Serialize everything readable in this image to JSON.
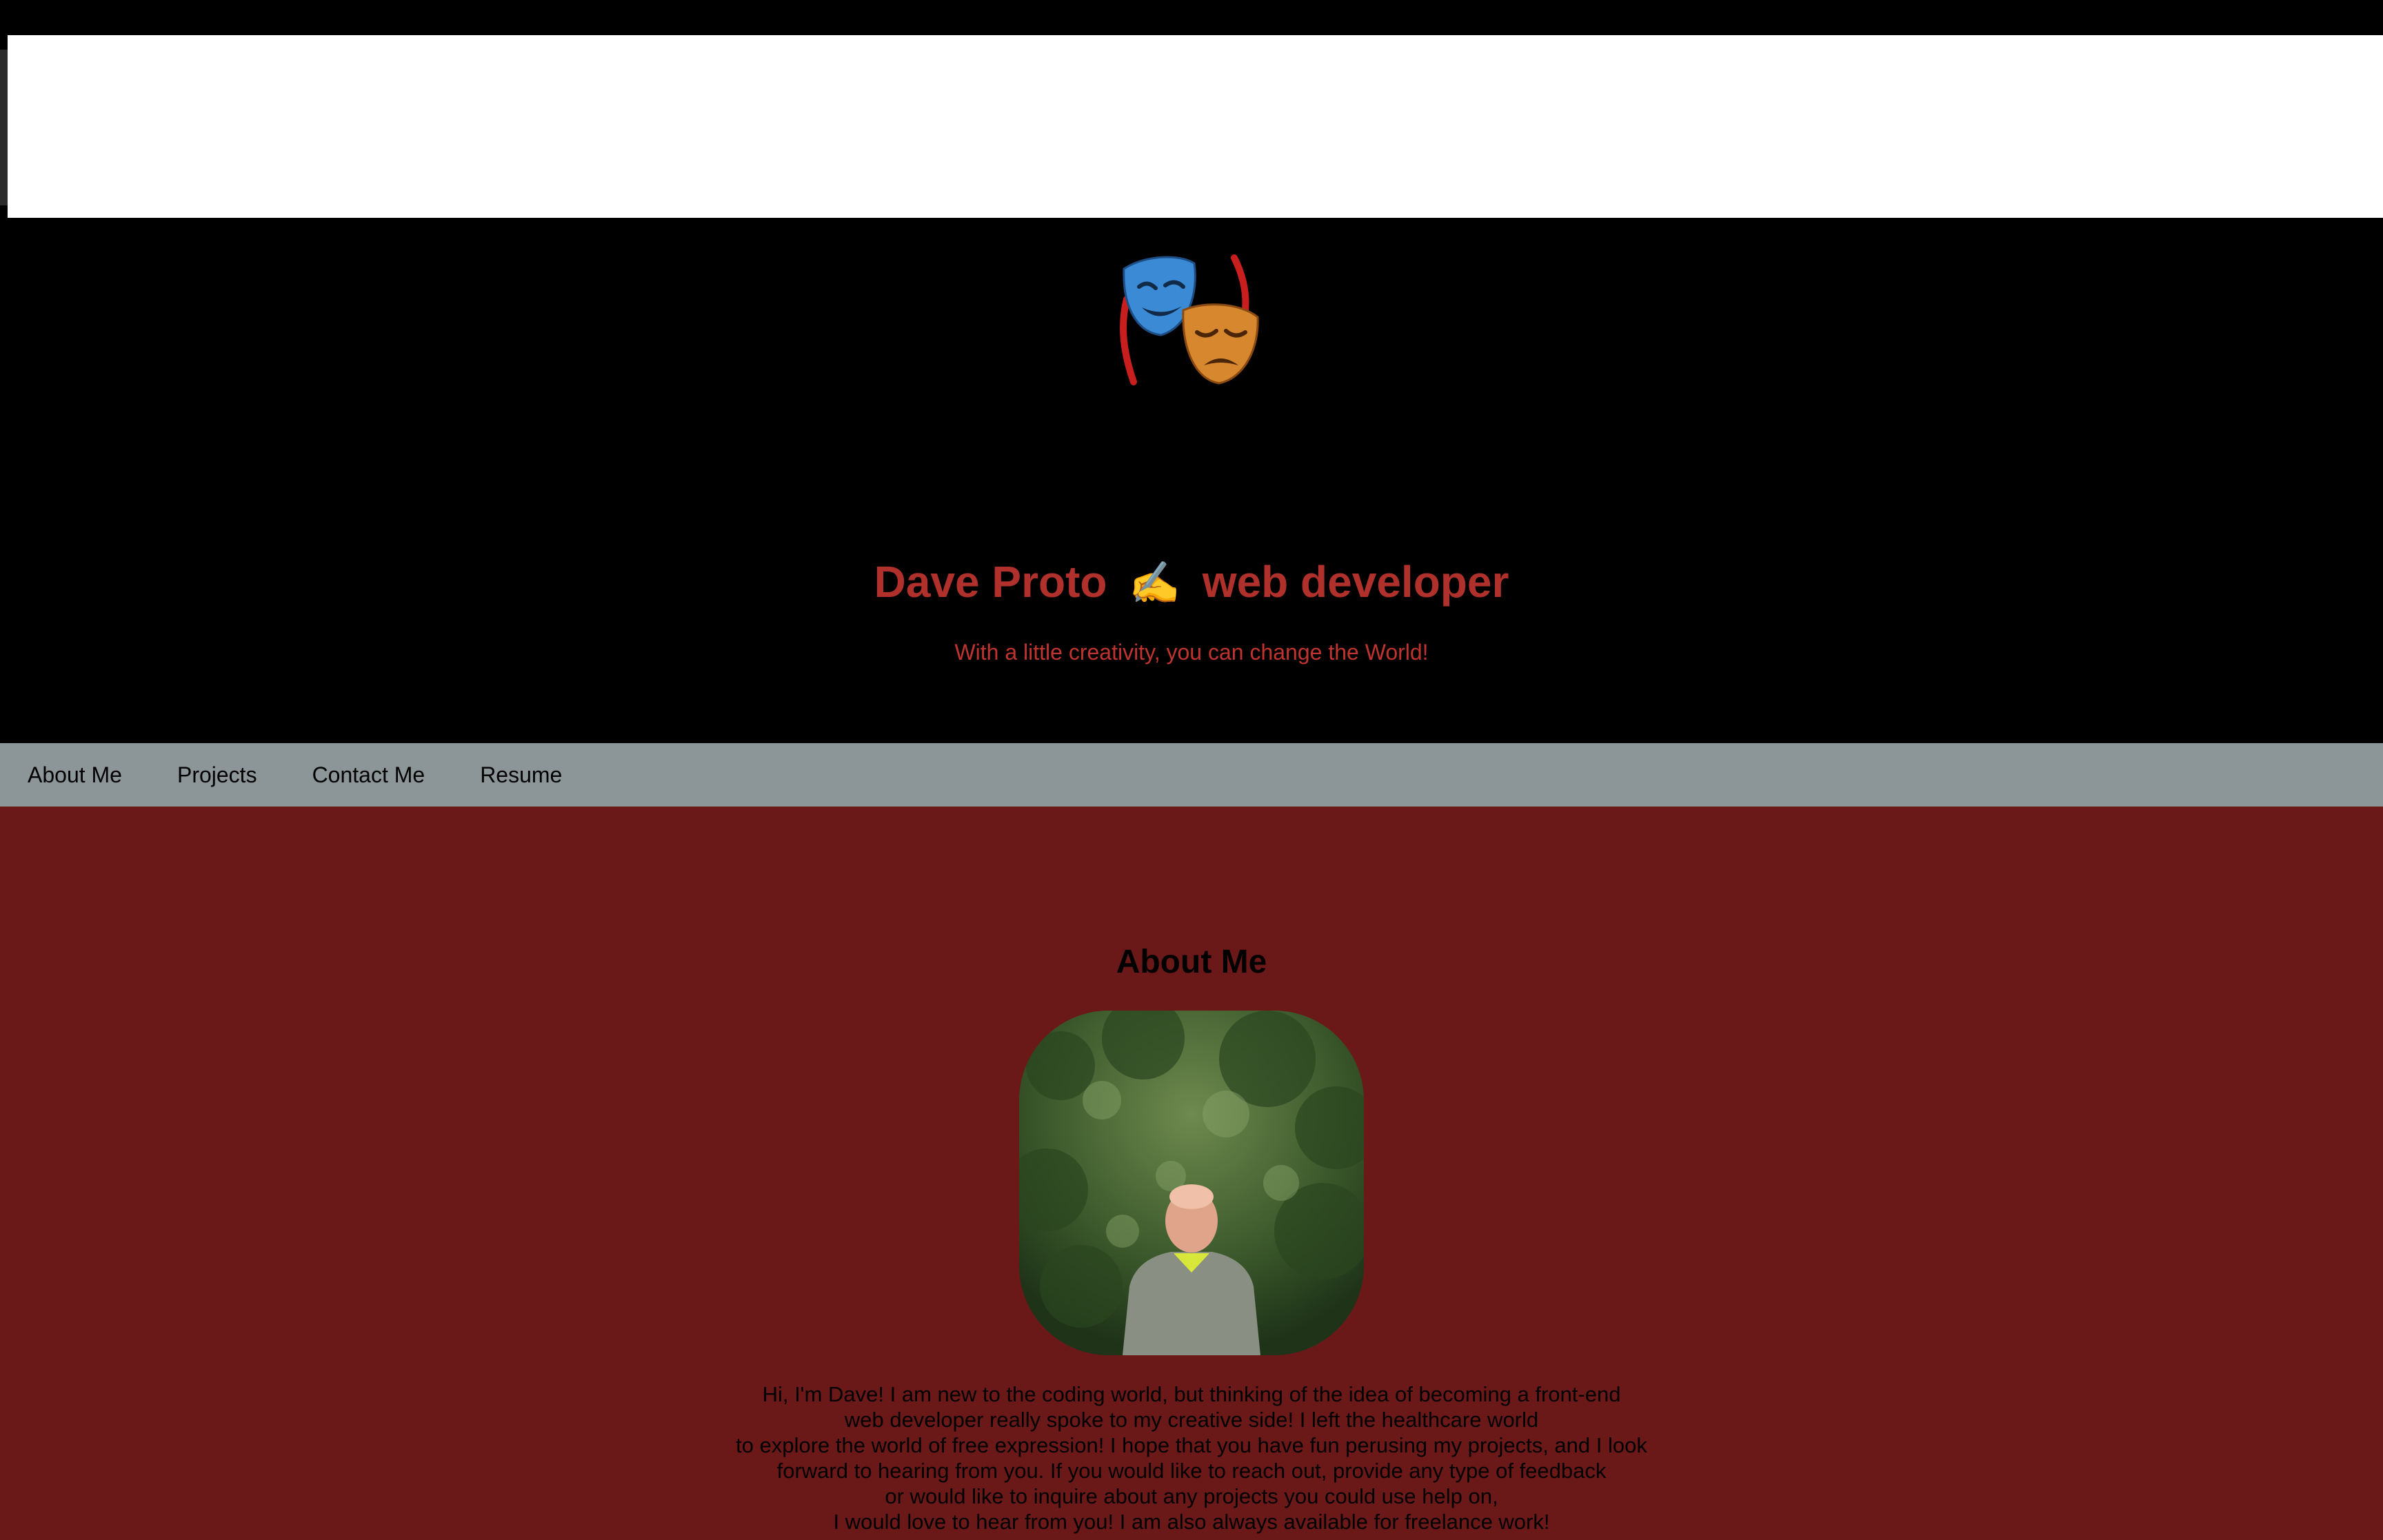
{
  "header": {
    "logo_icon": "theater-masks-icon",
    "title_name": "Dave Proto",
    "title_emoji": "✍",
    "title_role": "web developer",
    "tagline": "With a little creativity, you can change the World!"
  },
  "nav": {
    "items": [
      {
        "label": "About Me"
      },
      {
        "label": "Projects"
      },
      {
        "label": "Contact Me"
      },
      {
        "label": "Resume"
      }
    ]
  },
  "about": {
    "heading": "About Me",
    "bio_lines": [
      "Hi, I'm Dave! I am new to the coding world, but thinking of the idea of becoming a front-end",
      "web developer really spoke to my creative side! I left the healthcare world",
      "to explore the world of free expression! I hope that you have fun perusing my projects, and I look",
      "forward to hearing from you. If you would like to reach out, provide any type of feedback",
      "or would like to inquire about any projects you could use help on,",
      "I would love to hear from you! I am also always available for freelance work!"
    ]
  },
  "colors": {
    "header_bg": "#000000",
    "title_color": "#b0302c",
    "nav_bg": "#8c9698",
    "main_bg": "#6b1818"
  }
}
